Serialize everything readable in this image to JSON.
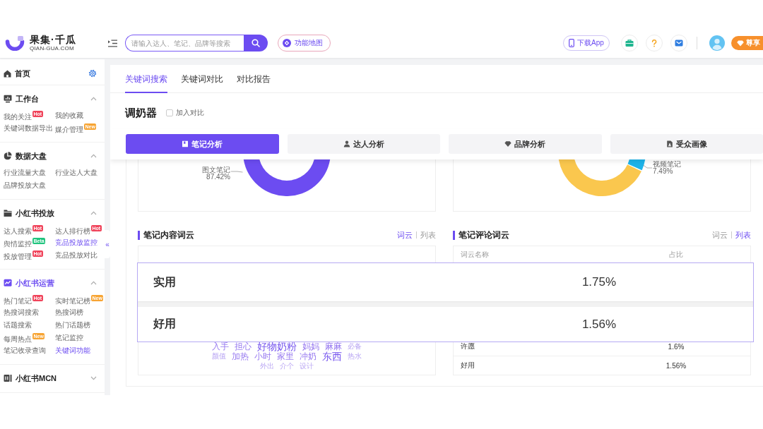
{
  "header": {
    "logo": {
      "name": "果集·千瓜",
      "domain": "QIAN-GUA.COM"
    },
    "search": {
      "placeholder": "请输入达人、笔记、品牌等搜索"
    },
    "map_button": "功能地图",
    "download_button": "下载App",
    "vip_button": "尊享"
  },
  "sidebar": {
    "home": "首页",
    "collapse": "«",
    "sections": [
      {
        "title": "工作台",
        "expanded": true,
        "selected": false,
        "items": [
          {
            "label": "我的关注",
            "selected": false,
            "badge": {
              "text": "Hot",
              "color": "#f0435a"
            }
          },
          {
            "label": "我的收藏",
            "selected": false
          },
          {
            "label": "关键词数据导出",
            "selected": false
          },
          {
            "label": "媒介管理",
            "selected": false,
            "badge": {
              "text": "New",
              "color": "#f7a433"
            }
          }
        ]
      },
      {
        "title": "数据大盘",
        "expanded": true,
        "selected": false,
        "items": [
          {
            "label": "行业流量大盘",
            "selected": false
          },
          {
            "label": "行业达人大盘",
            "selected": false
          },
          {
            "label": "品牌投放大盘",
            "selected": false
          }
        ]
      },
      {
        "title": "小红书投放",
        "expanded": true,
        "selected": false,
        "items": [
          {
            "label": "达人搜索",
            "selected": false,
            "badge": {
              "text": "Hot",
              "color": "#f0435a"
            }
          },
          {
            "label": "达人排行榜",
            "selected": false,
            "badge": {
              "text": "Hot",
              "color": "#f0435a"
            }
          },
          {
            "label": "舆情监控",
            "selected": false,
            "badge": {
              "text": "Beta",
              "color": "#20c47e"
            }
          },
          {
            "label": "竞品投放监控",
            "selected": true
          },
          {
            "label": "投放管理",
            "selected": false,
            "badge": {
              "text": "Hot",
              "color": "#f0435a"
            }
          },
          {
            "label": "竞品投放对比",
            "selected": false
          }
        ]
      },
      {
        "title": "小红书运营",
        "expanded": true,
        "selected": true,
        "items": [
          {
            "label": "热门笔记",
            "selected": false,
            "badge": {
              "text": "Hot",
              "color": "#f0435a"
            }
          },
          {
            "label": "实时笔记榜",
            "selected": false,
            "badge": {
              "text": "New",
              "color": "#f7a433"
            }
          },
          {
            "label": "热搜词搜索",
            "selected": false
          },
          {
            "label": "热搜词榜",
            "selected": false
          },
          {
            "label": "话题搜索",
            "selected": false
          },
          {
            "label": "热门话题榜",
            "selected": false
          },
          {
            "label": "每周热点",
            "selected": false,
            "badge": {
              "text": "New",
              "color": "#f7a433"
            }
          },
          {
            "label": "笔记监控",
            "selected": false
          },
          {
            "label": "笔记收录查询",
            "selected": false
          },
          {
            "label": "关键词功能",
            "selected": true
          }
        ]
      },
      {
        "title": "小红书MCN",
        "expanded": false,
        "selected": false
      }
    ]
  },
  "main_tabs": [
    {
      "label": "关键词搜索",
      "selected": true
    },
    {
      "label": "关键词对比",
      "selected": false
    },
    {
      "label": "对比报告",
      "selected": false
    }
  ],
  "keyword": {
    "title": "调奶器",
    "compare": {
      "label": "加入对比",
      "checked": false
    }
  },
  "analysis_tabs": [
    {
      "label": "笔记分析",
      "selected": true
    },
    {
      "label": "达人分析",
      "selected": false
    },
    {
      "label": "品牌分析",
      "selected": false
    },
    {
      "label": "受众画像",
      "selected": false
    }
  ],
  "donut_cards": [
    {
      "label": "图文笔记",
      "value": "87.42%"
    },
    {
      "label": "视频笔记",
      "value": "7.49%"
    }
  ],
  "panels": [
    {
      "kind": "cloud",
      "title": "笔记内容词云",
      "toggle": [
        {
          "label": "词云",
          "selected": true
        },
        {
          "label": "列表",
          "selected": false
        }
      ],
      "word_rows": [
        [
          {
            "text": "入手",
            "kind": "medium"
          },
          {
            "text": "担心",
            "kind": "medium"
          },
          {
            "text": "好物奶粉",
            "kind": "large"
          },
          {
            "text": "妈妈",
            "kind": "medium"
          },
          {
            "text": "麻麻",
            "kind": "medium"
          },
          {
            "text": "必备",
            "kind": "small"
          }
        ],
        [
          {
            "text": "颜值",
            "kind": "small"
          },
          {
            "text": "加热",
            "kind": "medium"
          },
          {
            "text": "小时",
            "kind": "medium"
          },
          {
            "text": "家里",
            "kind": "medium"
          },
          {
            "text": "冲奶",
            "kind": "medium"
          },
          {
            "text": "东西",
            "kind": "large"
          },
          {
            "text": "热水",
            "kind": "small"
          }
        ],
        [
          {
            "text": "外出",
            "kind": "small"
          },
          {
            "text": "介个",
            "kind": "small"
          },
          {
            "text": "设计",
            "kind": "small"
          }
        ]
      ]
    },
    {
      "kind": "table",
      "title": "笔记评论词云",
      "toggle": [
        {
          "label": "词云",
          "selected": false
        },
        {
          "label": "列表",
          "selected": true
        }
      ],
      "table": {
        "columns": [
          "词云名称",
          "占比"
        ],
        "rows": [
          [
            "许愿",
            "1.6%"
          ],
          [
            "好用",
            "1.56%"
          ]
        ]
      }
    }
  ],
  "magnifier": {
    "rows": [
      {
        "word": "实用",
        "share": "1.75%"
      },
      {
        "word": "好用",
        "share": "1.56%"
      }
    ]
  }
}
